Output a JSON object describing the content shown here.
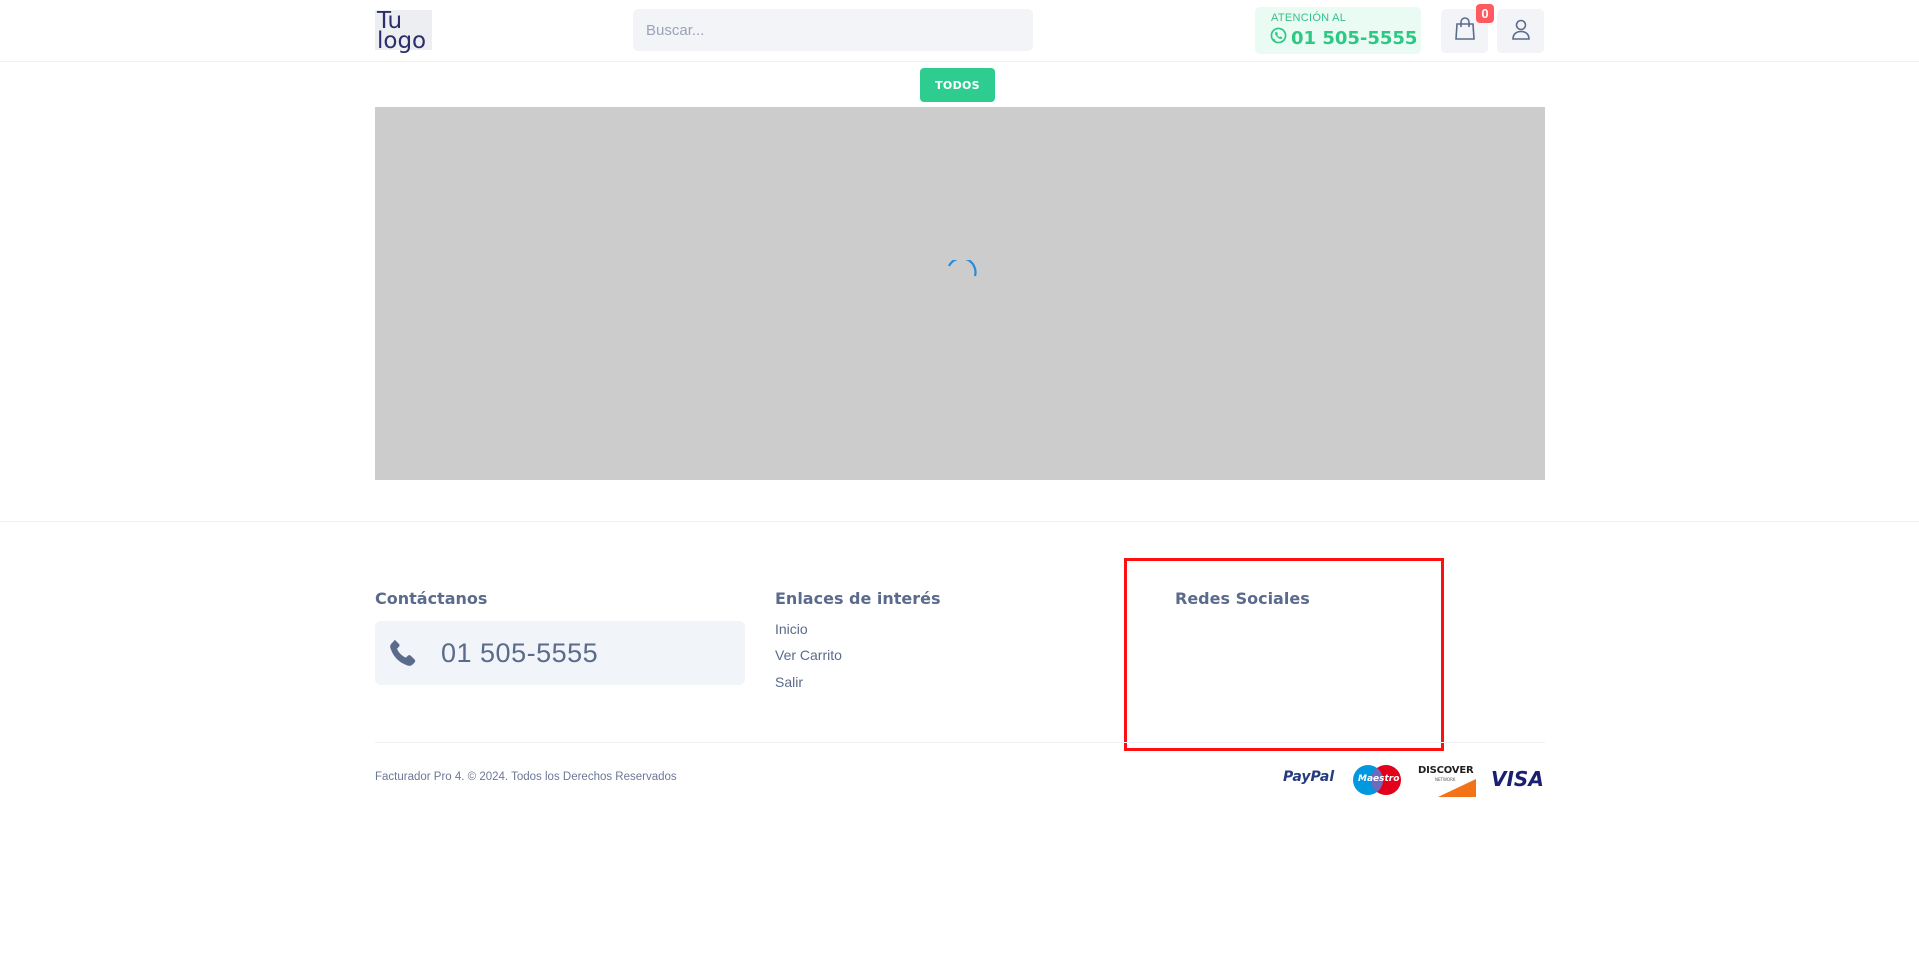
{
  "header": {
    "logo": {
      "line1": "Tu",
      "line2": "logo"
    },
    "search": {
      "placeholder": "Buscar...",
      "value": ""
    },
    "attention": {
      "label": "ATENCIÓN AL",
      "phone": "01 505-5555",
      "icon": "whatsapp-icon"
    },
    "cart": {
      "count": "0",
      "icon": "shopping-bag-icon"
    },
    "user": {
      "icon": "user-icon"
    }
  },
  "categories": [
    {
      "label": "TODOS"
    }
  ],
  "banner": {
    "state": "loading",
    "icon": "spinner-icon"
  },
  "footer": {
    "contact": {
      "title": "Contáctanos",
      "phone": "01 505-5555",
      "icon": "phone-icon"
    },
    "links": {
      "title": "Enlaces de interés",
      "items": [
        {
          "label": "Inicio"
        },
        {
          "label": "Ver Carrito"
        },
        {
          "label": "Salir"
        }
      ]
    },
    "social": {
      "title": "Redes Sociales"
    },
    "copyright": "Facturador Pro 4. © 2024. Todos los Derechos Reservados",
    "payments": [
      {
        "name": "PayPal",
        "icon": "paypal-icon"
      },
      {
        "name": "Maestro",
        "icon": "maestro-icon"
      },
      {
        "name": "DISCOVER",
        "sub": "NETWORK",
        "icon": "discover-icon"
      },
      {
        "name": "VISA",
        "icon": "visa-icon"
      }
    ]
  },
  "colors": {
    "accent": "#2ecc8f",
    "text": "#5b6b8c",
    "badge": "#ff5a5f",
    "highlight": "#ff1010",
    "banner": "#cccccc"
  }
}
